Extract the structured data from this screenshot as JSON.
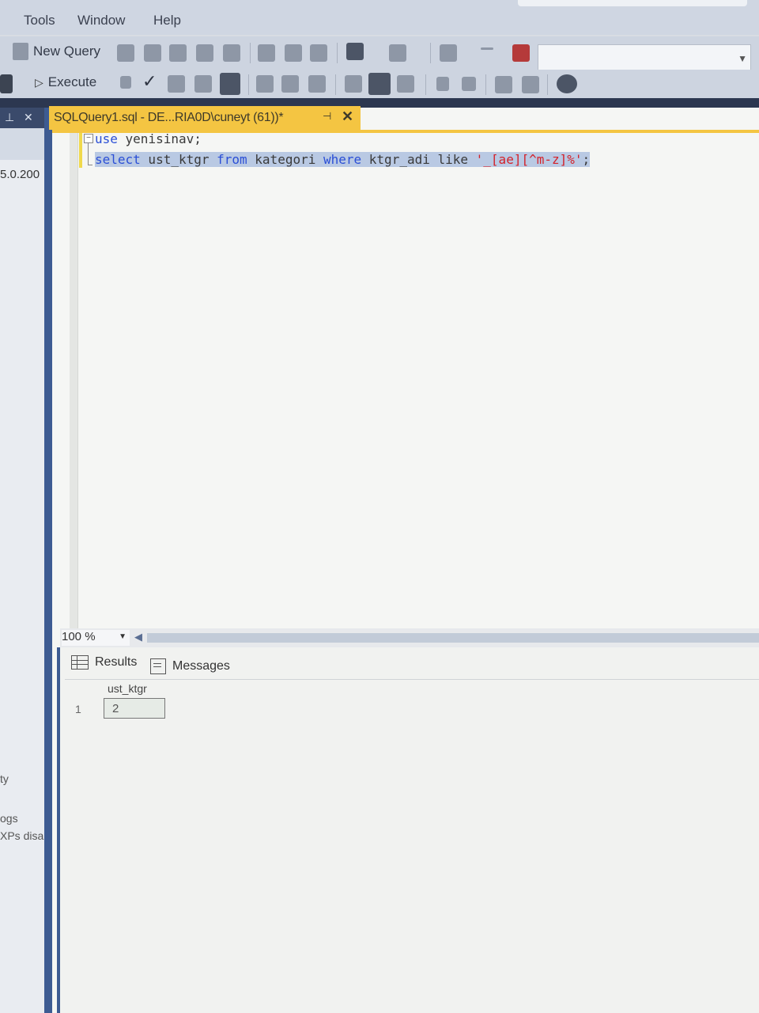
{
  "menu": {
    "items": [
      "Tools",
      "Window",
      "Help"
    ]
  },
  "toolbar": {
    "new_query_label": "New Query",
    "execute_label": "Execute"
  },
  "left_panel": {
    "version_fragment": "5.0.200",
    "text_ty": "ty",
    "text_ogs": "ogs",
    "text_xps": "XPs disabl"
  },
  "document_tab": {
    "title": "SQLQuery1.sql - DE...RIA0D\\cuneyt (61))*",
    "pin_icon": "pin-icon",
    "close_icon": "close-icon"
  },
  "editor": {
    "line1": {
      "keyword": "use",
      "rest": " yenisinav;"
    },
    "line2": {
      "kw_select": "select",
      "t1": " ust_ktgr ",
      "kw_from": "from",
      "t2": " kategori ",
      "kw_where": "where",
      "t3": " ktgr_adi like ",
      "string": "'_[ae][^m-z]%'",
      "semi": ";"
    }
  },
  "zoom": {
    "value": "100 %"
  },
  "results": {
    "tab_results": "Results",
    "tab_messages": "Messages",
    "columns": [
      "ust_ktgr"
    ],
    "rows": [
      {
        "num": "1",
        "values": [
          "2"
        ]
      }
    ]
  },
  "colors": {
    "tab_active": "#f4c542",
    "keyword": "#2b4fd6",
    "string": "#d4222a",
    "splitter": "#3d5b92"
  }
}
